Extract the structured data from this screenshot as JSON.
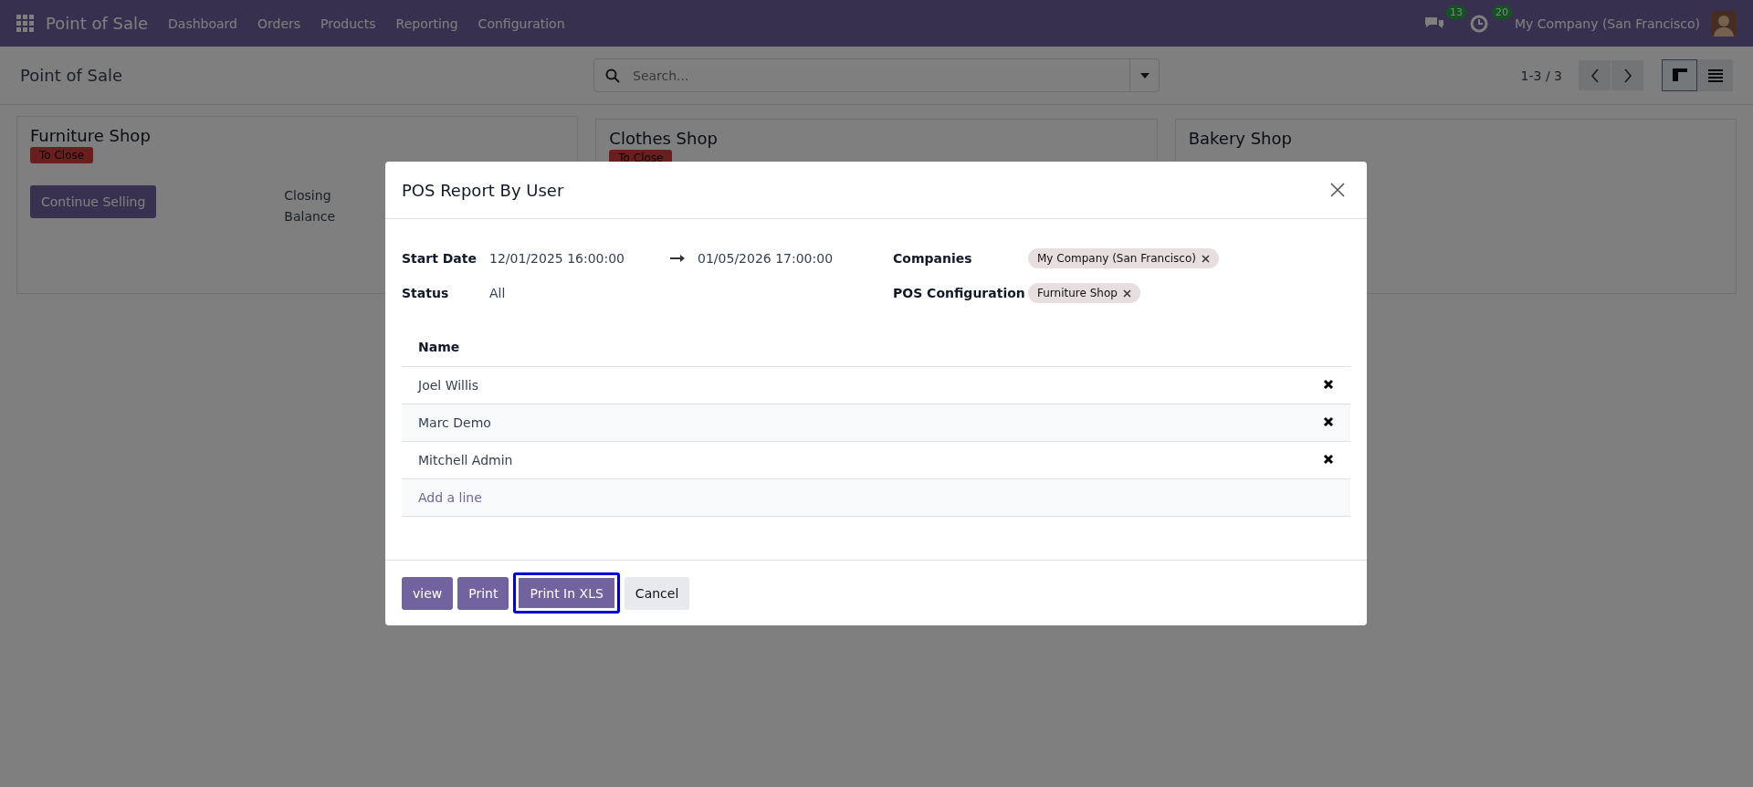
{
  "navbar": {
    "app_name": "Point of Sale",
    "menu": [
      "Dashboard",
      "Orders",
      "Products",
      "Reporting",
      "Configuration"
    ],
    "messages_count": "13",
    "activities_count": "20",
    "company": "My Company (San Francisco)"
  },
  "control_panel": {
    "title": "Point of Sale",
    "search": {
      "placeholder": "Search..."
    },
    "pager": "1-3 / 3",
    "views": [
      {
        "kind": "kanban",
        "selected": true
      },
      {
        "kind": "list",
        "selected": false
      }
    ]
  },
  "cards": [
    {
      "name": "Furniture Shop",
      "badge": "To Close",
      "button": "Continue Selling",
      "closing_label": "Closing Balance"
    },
    {
      "name": "Clothes Shop",
      "badge": "To Close"
    },
    {
      "name": "Bakery Shop"
    }
  ],
  "dialog": {
    "title": "POS Report By User",
    "left_fields": [
      {
        "kind": "daterange",
        "label": "Start Date",
        "start": "12/01/2025 16:00:00",
        "end": "01/05/2026 17:00:00"
      },
      {
        "kind": "text",
        "label": "Status",
        "value": "All"
      }
    ],
    "right_fields": [
      {
        "kind": "tags",
        "label": "Companies",
        "tags": [
          "My Company (San Francisco)"
        ]
      },
      {
        "kind": "tags",
        "label": "POS Configuration",
        "tags": [
          "Furniture Shop"
        ]
      }
    ],
    "table": {
      "columns": [
        "Name"
      ],
      "rows": [
        "Joel Willis",
        "Marc Demo",
        "Mitchell Admin"
      ],
      "add_line": "Add a line"
    },
    "buttons": [
      {
        "label": "view",
        "kind": "primary",
        "highlighted": false
      },
      {
        "label": "Print",
        "kind": "primary",
        "highlighted": false
      },
      {
        "label": "Print In XLS",
        "kind": "primary",
        "highlighted": true
      },
      {
        "label": "Cancel",
        "kind": "secondary",
        "highlighted": false
      }
    ]
  }
}
